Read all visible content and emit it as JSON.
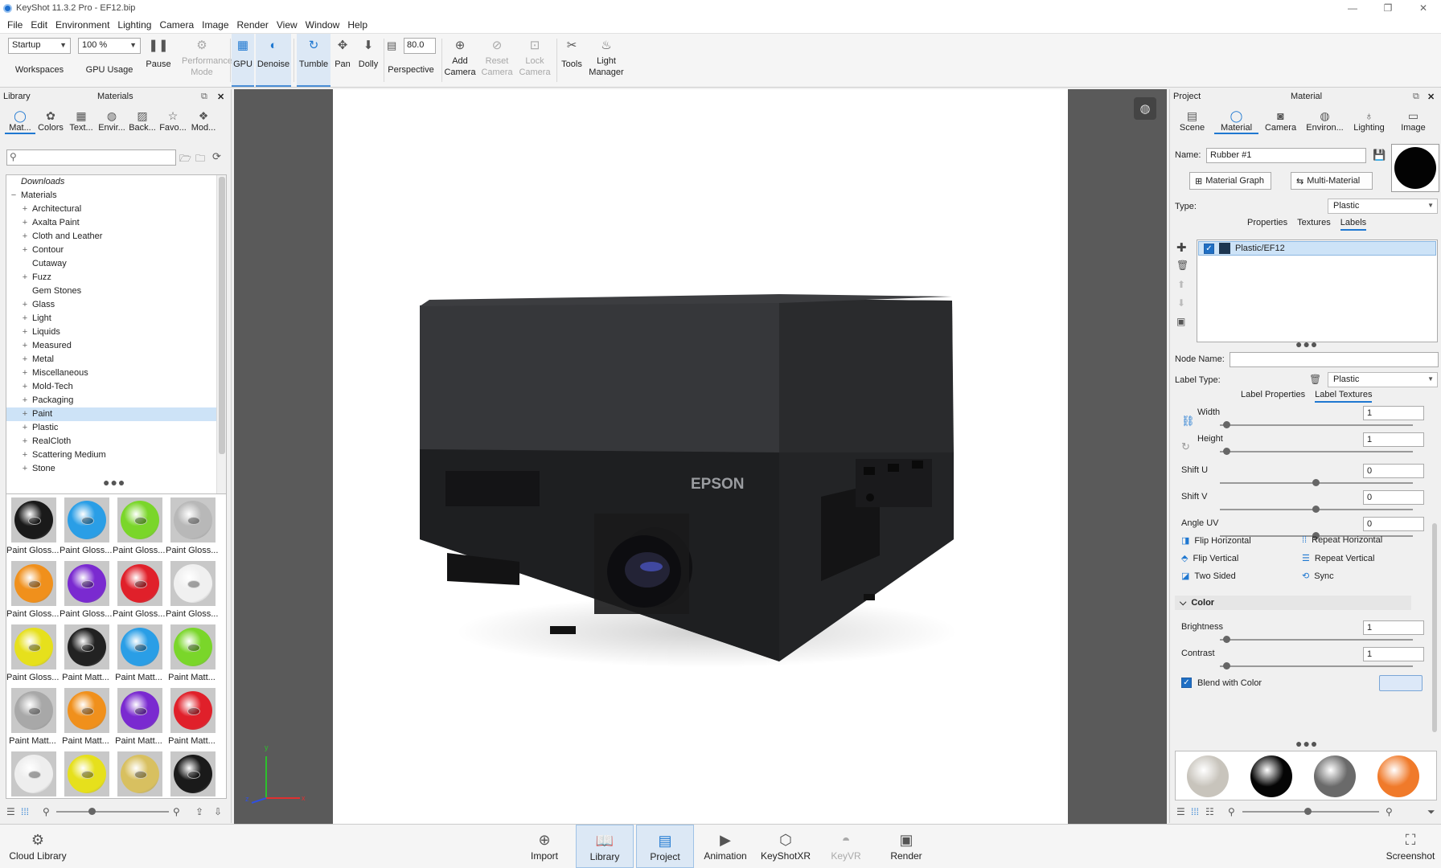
{
  "window": {
    "title": "KeyShot 11.3.2 Pro  - EF12.bip"
  },
  "menu": [
    "File",
    "Edit",
    "Environment",
    "Lighting",
    "Camera",
    "Image",
    "Render",
    "View",
    "Window",
    "Help"
  ],
  "toolbar": {
    "workspace_value": "Startup",
    "workspace_label": "Workspaces",
    "gpu_value": "100 %",
    "gpu_label": "GPU Usage",
    "pause": "Pause",
    "performance": "Performance Mode",
    "gpu": "GPU",
    "denoise": "Denoise",
    "tumble": "Tumble",
    "pan": "Pan",
    "dolly": "Dolly",
    "fov_value": "80.0",
    "perspective": "Perspective",
    "add_camera": "Add Camera",
    "reset_camera": "Reset Camera",
    "lock_camera": "Lock Camera",
    "tools": "Tools",
    "light_manager": "Light Manager"
  },
  "library": {
    "header_left": "Library",
    "header_title": "Materials",
    "tabs": [
      "Mat...",
      "Colors",
      "Text...",
      "Envir...",
      "Back...",
      "Favo...",
      "Mod..."
    ],
    "search_placeholder": "",
    "tree": [
      {
        "label": "Downloads",
        "italic": true,
        "expandable": false
      },
      {
        "label": "Materials",
        "expandable": true,
        "open": true
      },
      {
        "label": "Architectural",
        "expandable": true
      },
      {
        "label": "Axalta Paint",
        "expandable": true
      },
      {
        "label": "Cloth and Leather",
        "expandable": true
      },
      {
        "label": "Contour",
        "expandable": true
      },
      {
        "label": "Cutaway",
        "expandable": false
      },
      {
        "label": "Fuzz",
        "expandable": true
      },
      {
        "label": "Gem Stones",
        "expandable": false
      },
      {
        "label": "Glass",
        "expandable": true
      },
      {
        "label": "Light",
        "expandable": true
      },
      {
        "label": "Liquids",
        "expandable": true
      },
      {
        "label": "Measured",
        "expandable": true
      },
      {
        "label": "Metal",
        "expandable": true
      },
      {
        "label": "Miscellaneous",
        "expandable": true
      },
      {
        "label": "Mold-Tech",
        "expandable": true
      },
      {
        "label": "Packaging",
        "expandable": true
      },
      {
        "label": "Paint",
        "expandable": true,
        "selected": true
      },
      {
        "label": "Plastic",
        "expandable": true
      },
      {
        "label": "RealCloth",
        "expandable": true
      },
      {
        "label": "Scattering Medium",
        "expandable": true
      },
      {
        "label": "Stone",
        "expandable": true
      }
    ],
    "thumbnails": [
      {
        "label": "Paint Gloss...",
        "color": "#1a1a1a"
      },
      {
        "label": "Paint Gloss...",
        "color": "#2a9ee6"
      },
      {
        "label": "Paint Gloss...",
        "color": "#7ad62a"
      },
      {
        "label": "Paint Gloss...",
        "color": "#b8b8b8"
      },
      {
        "label": "Paint Gloss...",
        "color": "#f0901c"
      },
      {
        "label": "Paint Gloss...",
        "color": "#7a2ad0"
      },
      {
        "label": "Paint Gloss...",
        "color": "#e0202a"
      },
      {
        "label": "Paint Gloss...",
        "color": "#f0f0f0"
      },
      {
        "label": "Paint Gloss...",
        "color": "#e6e01c"
      },
      {
        "label": "Paint Matt...",
        "color": "#222222"
      },
      {
        "label": "Paint Matt...",
        "color": "#2a9ee6"
      },
      {
        "label": "Paint Matt...",
        "color": "#7ad62a"
      },
      {
        "label": "Paint Matt...",
        "color": "#a8a8a8"
      },
      {
        "label": "Paint Matt...",
        "color": "#f0901c"
      },
      {
        "label": "Paint Matt...",
        "color": "#7a2ad0"
      },
      {
        "label": "Paint Matt...",
        "color": "#e0202a"
      },
      {
        "label": "",
        "color": "#eeeeee"
      },
      {
        "label": "",
        "color": "#e6e01c"
      },
      {
        "label": "",
        "color": "#d8c060"
      },
      {
        "label": "",
        "color": "#1a1a1a"
      }
    ]
  },
  "viewport": {
    "brand_text": "EPSON",
    "axis_y": "y",
    "axis_x": "x",
    "axis_z": "z"
  },
  "project": {
    "header_left": "Project",
    "header_title": "Material",
    "tabs": [
      "Scene",
      "Material",
      "Camera",
      "Environ...",
      "Lighting",
      "Image"
    ],
    "name_label": "Name:",
    "name_value": "Rubber #1",
    "material_graph": "Material Graph",
    "multi_material": "Multi-Material",
    "type_label": "Type:",
    "type_value": "Plastic",
    "subtabs": [
      "Properties",
      "Textures",
      "Labels"
    ],
    "label_item": "Plastic/EF12",
    "node_name_label": "Node Name:",
    "node_name_value": "",
    "label_type_label": "Label Type:",
    "label_type_value": "Plastic",
    "label_tabs": [
      "Label Properties",
      "Label Textures"
    ],
    "params": [
      {
        "label": "Width",
        "value": "1",
        "pos": 0.0
      },
      {
        "label": "Height",
        "value": "1",
        "pos": 0.0
      },
      {
        "label": "Shift U",
        "value": "0",
        "pos": 0.5
      },
      {
        "label": "Shift V",
        "value": "0",
        "pos": 0.5
      },
      {
        "label": "Angle UV",
        "value": "0",
        "pos": 0.5
      }
    ],
    "flip_horizontal": "Flip Horizontal",
    "repeat_horizontal": "Repeat Horizontal",
    "flip_vertical": "Flip Vertical",
    "repeat_vertical": "Repeat Vertical",
    "two_sided": "Two Sided",
    "sync": "Sync",
    "color_section": "Color",
    "brightness_label": "Brightness",
    "brightness_value": "1",
    "contrast_label": "Contrast",
    "contrast_value": "1",
    "blend_label": "Blend with Color",
    "blend_color": "#dce8f8",
    "swatches": [
      "#c8c4bc",
      "#050505",
      "#6a6a6a",
      "#f07a2a"
    ]
  },
  "bottom": {
    "cloud_library": "Cloud Library",
    "import": "Import",
    "library": "Library",
    "project": "Project",
    "animation": "Animation",
    "keyshotxr": "KeyShotXR",
    "keyvr": "KeyVR",
    "render": "Render",
    "screenshot": "Screenshot"
  },
  "colors": {
    "accent": "#1f78d1",
    "selection": "#cde3f7"
  }
}
